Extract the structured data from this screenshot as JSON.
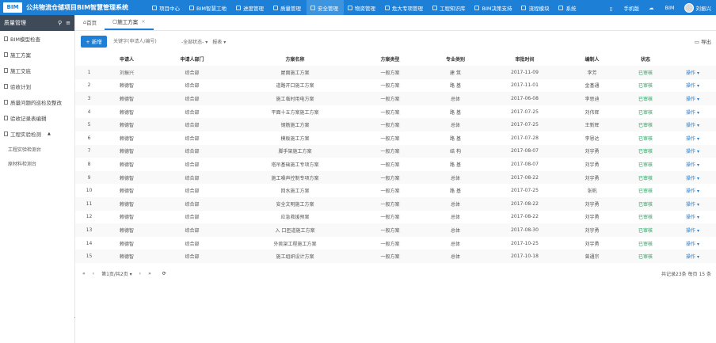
{
  "app": {
    "logo": "BIM",
    "title": "公共物流仓储项目BIM智慧管理系统"
  },
  "topnav": [
    {
      "label": "项目中心",
      "active": false
    },
    {
      "label": "BIM智慧工地",
      "active": false
    },
    {
      "label": "进度管理",
      "active": false
    },
    {
      "label": "质量管理",
      "active": false
    },
    {
      "label": "安全管理",
      "active": true
    },
    {
      "label": "物资管理",
      "active": false
    },
    {
      "label": "危大专项管理",
      "active": false
    },
    {
      "label": "工程知识库",
      "active": false
    },
    {
      "label": "BIM决策支持",
      "active": false
    },
    {
      "label": "流程模块",
      "active": false
    },
    {
      "label": "系统",
      "active": false
    }
  ],
  "top_right": {
    "mobile": "手机版",
    "bim": "BIM",
    "user": "刘振兴"
  },
  "sidebar": {
    "title": "质量管理",
    "items": [
      {
        "label": "BIM模型检查",
        "icon": "model-icon"
      },
      {
        "label": "施工方案",
        "icon": "doc-icon"
      },
      {
        "label": "施工交底",
        "icon": "doc-icon"
      },
      {
        "label": "验收计划",
        "icon": "doc-icon"
      },
      {
        "label": "质量问题的巡检及整改",
        "icon": "doc-icon"
      },
      {
        "label": "验收记录表编辑",
        "icon": "doc-icon"
      },
      {
        "label": "工程实验检测",
        "icon": "doc-icon"
      }
    ],
    "subitems": [
      "工程实验检测台",
      "原材料检测台"
    ]
  },
  "tabs": [
    {
      "label": "首页",
      "active": false
    },
    {
      "label": "施工方案",
      "active": true
    }
  ],
  "toolbar": {
    "add_label": "+ 新增",
    "search_placeholder": "关键字(申请人/编号)",
    "filter_status": "-全部状态-",
    "filter_report": "报表",
    "export_label": "导出"
  },
  "table": {
    "headers": [
      "",
      "申请人",
      "申请人部门",
      "方案名称",
      "方案类型",
      "专业类别",
      "审批时间",
      "编制人",
      "状态",
      ""
    ],
    "rows": [
      [
        "1",
        "刘振兴",
        "综合部",
        "屋面施工方案",
        "一般方案",
        "建 筑",
        "2017-11-09",
        "李芳",
        "已审核",
        "操作"
      ],
      [
        "2",
        "赖德智",
        "综合部",
        "道路开口施工方案",
        "一般方案",
        "路 基",
        "2017-11-01",
        "金基通",
        "已审核",
        "操作"
      ],
      [
        "3",
        "赖德智",
        "综合部",
        "施工临时用电方案",
        "一般方案",
        "总体",
        "2017-06-08",
        "李思迪",
        "已审核",
        "操作"
      ],
      [
        "4",
        "赖德智",
        "综合部",
        "平面十五方案施工方案",
        "一般方案",
        "路 基",
        "2017-07-25",
        "刘伟辉",
        "已审核",
        "操作"
      ],
      [
        "5",
        "赖德智",
        "综合部",
        "钢筋施工方案",
        "一般方案",
        "总体",
        "2017-07-25",
        "王新辉",
        "已审核",
        "操作"
      ],
      [
        "6",
        "赖德智",
        "综合部",
        "模板施工方案",
        "一般方案",
        "路 基",
        "2017-07-28",
        "李恩达",
        "已审核",
        "操作"
      ],
      [
        "7",
        "赖德智",
        "综合部",
        "脚手架施工方案",
        "一般方案",
        "结 构",
        "2017-08-07",
        "刘宇勇",
        "已审核",
        "操作"
      ],
      [
        "8",
        "赖德智",
        "综合部",
        "塔吊基础施工专项方案",
        "一般方案",
        "路 基",
        "2017-08-07",
        "刘宇勇",
        "已审核",
        "操作"
      ],
      [
        "9",
        "赖德智",
        "综合部",
        "施工噪声控制专项方案",
        "一般方案",
        "总体",
        "2017-08-22",
        "刘宇勇",
        "已审核",
        "操作"
      ],
      [
        "10",
        "赖德智",
        "综合部",
        "回水施工方案",
        "一般方案",
        "路 基",
        "2017-07-25",
        "张帆",
        "已审核",
        "操作"
      ],
      [
        "11",
        "赖德智",
        "综合部",
        "安全文明施工方案",
        "一般方案",
        "总体",
        "2017-08-22",
        "刘宇勇",
        "已审核",
        "操作"
      ],
      [
        "12",
        "赖德智",
        "综合部",
        "应急救援预案",
        "一般方案",
        "总体",
        "2017-08-22",
        "刘宇勇",
        "已审核",
        "操作"
      ],
      [
        "13",
        "赖德智",
        "综合部",
        "入 口匝道施工方案",
        "一般方案",
        "总体",
        "2017-08-30",
        "刘宇勇",
        "已审核",
        "操作"
      ],
      [
        "14",
        "赖德智",
        "综合部",
        "外挑架工程施工方案",
        "一般方案",
        "总体",
        "2017-10-25",
        "刘宇勇",
        "已审核",
        "操作"
      ],
      [
        "15",
        "赖德智",
        "综合部",
        "施工组织设计方案",
        "一般方案",
        "总体",
        "2017-10-18",
        "曾通宗",
        "已审核",
        "操作"
      ]
    ]
  },
  "pager": {
    "first": "«",
    "prev": "‹",
    "page_info": "第1页/共2页",
    "next": "›",
    "last": "»",
    "refresh": "⟳",
    "total": "共记录23条  每页  15  条"
  }
}
